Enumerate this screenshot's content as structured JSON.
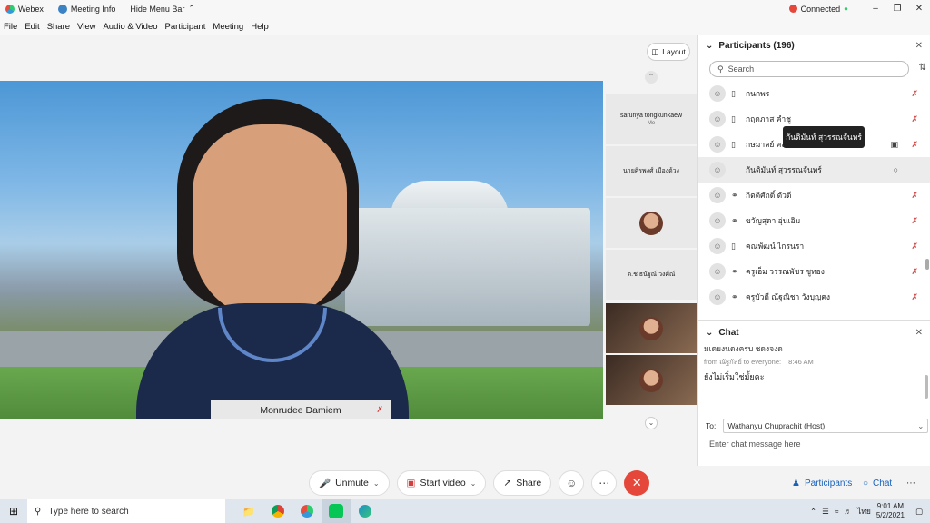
{
  "titlebar": {
    "app": "Webex",
    "meeting_info": "Meeting Info",
    "hide_menu": "Hide Menu Bar",
    "status": "Connected"
  },
  "menu": [
    "File",
    "Edit",
    "Share",
    "View",
    "Audio & Video",
    "Participant",
    "Meeting",
    "Help"
  ],
  "stage": {
    "layout_label": "Layout",
    "active_speaker": "Monrudee Damiem"
  },
  "thumbnails": [
    {
      "name": "sarunya tongkunkaew",
      "sub": "Me"
    },
    {
      "name": "นายศิรพงศ์ เมืองด้วง",
      "sub": ""
    },
    {
      "name": "",
      "sub": ""
    },
    {
      "name": "ด.ช ธนัฐณ์ วงศ์ณ์",
      "sub": ""
    }
  ],
  "controls": {
    "unmute": "Unmute",
    "start_video": "Start video",
    "share": "Share",
    "participants": "Participants",
    "chat": "Chat"
  },
  "participants": {
    "title": "Participants (196)",
    "search_placeholder": "Search",
    "tooltip": "กันติมันท์ สุวรรณจันทร์",
    "list": [
      {
        "name": "กนกพร",
        "device": "phone"
      },
      {
        "name": "กฤตภาส คำชู",
        "device": "phone"
      },
      {
        "name": "กษมาลย์ คงแก้ว",
        "device": "phone"
      },
      {
        "name": "กันติมันท์ สุวรรณจันทร์",
        "device": ""
      },
      {
        "name": "กิตติศักดิ์ ตัวดี",
        "device": "headset"
      },
      {
        "name": "ขวัญสุดา อุ่นเอิม",
        "device": "headset"
      },
      {
        "name": "คณพัฒน์ ไกรนรา",
        "device": "phone"
      },
      {
        "name": "ครูเอ็ม วรรณพัชร ชูทอง",
        "device": "headset"
      },
      {
        "name": "ครูบัวดี ณัฐณิชา วังบุญคง",
        "device": "headset"
      }
    ]
  },
  "chat": {
    "title": "Chat",
    "prev_line": "มเดยงนดงครบ ชดงจงด",
    "meta_from": "from ณัฐกัลย์ to everyone:",
    "meta_time": "8:46 AM",
    "message": "ยังไม่เริ่มใช่มั้ยคะ",
    "to_label": "To:",
    "to_value": "Wathanyu Chuprachit (Host)",
    "input_placeholder": "Enter chat message here"
  },
  "taskbar": {
    "search_placeholder": "Type here to search",
    "time": "9:01 AM",
    "date": "5/2/2021",
    "lang": "ไทย"
  }
}
